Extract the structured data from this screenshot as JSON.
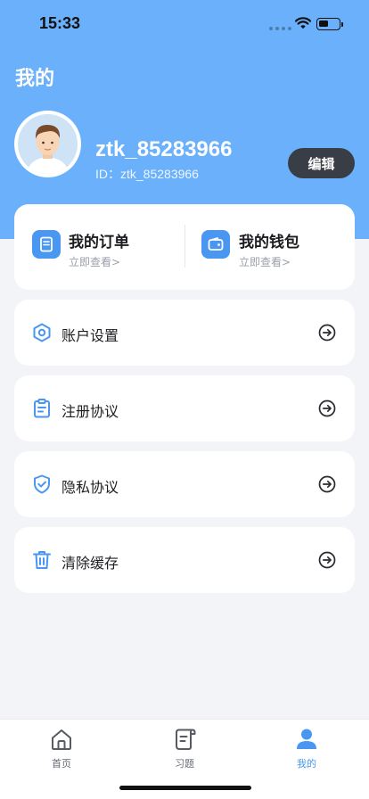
{
  "status_bar": {
    "time": "15:33",
    "icons": [
      "signal-dots-icon",
      "wifi-icon",
      "battery-icon"
    ]
  },
  "header": {
    "title": "我的"
  },
  "profile": {
    "username": "ztk_85283966",
    "id_text": "ID：ztk_85283966",
    "edit_label": "编辑"
  },
  "quick_actions": [
    {
      "title": "我的订单",
      "subtitle": "立即查看>",
      "icon": "order-icon"
    },
    {
      "title": "我的钱包",
      "subtitle": "立即查看>",
      "icon": "wallet-icon"
    }
  ],
  "menu": [
    {
      "label": "账户设置",
      "icon": "hexagon-settings-icon"
    },
    {
      "label": "注册协议",
      "icon": "clipboard-icon"
    },
    {
      "label": "隐私协议",
      "icon": "shield-check-icon"
    },
    {
      "label": "清除缓存",
      "icon": "trash-icon"
    }
  ],
  "tab_bar": [
    {
      "label": "首页",
      "icon": "home-icon",
      "active": false
    },
    {
      "label": "习题",
      "icon": "scroll-icon",
      "active": false
    },
    {
      "label": "我的",
      "icon": "user-icon",
      "active": true
    }
  ],
  "colors": {
    "hero": "#6ab0fb",
    "accent": "#4a97f2",
    "edit_button": "#393d45",
    "background": "#f3f4f8"
  }
}
